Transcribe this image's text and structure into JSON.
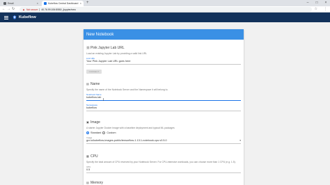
{
  "browser": {
    "tabs": [
      {
        "title": "Email",
        "active": false
      },
      {
        "title": "Kubeflow Central Dashboard",
        "active": true
      }
    ],
    "new_tab": "+",
    "window_controls": [
      "–",
      "□",
      "×"
    ],
    "security_label": "Not secure",
    "url": "40.76.99.106:8080/_/jupyter/new"
  },
  "appbar": {
    "title": "Kubeflow"
  },
  "form": {
    "title": "New Notebook",
    "pink_url": {
      "section_title": "Pink Jupyter Lab URL",
      "description": "Load an existing Jupyter Lab by providing a valid link URL",
      "field_label": "Link URL",
      "field_value": "Your Pink Jupyter Lab URL goes here",
      "button_label": "CONNECT"
    },
    "name": {
      "section_title": "Name",
      "description": "Specify the name of the Notebook Server and the Namespace it will belong to.",
      "name_label": "Notebook Name",
      "name_value": "kubeflow-lab",
      "namespace_label": "Namespace",
      "namespace_value": "kubeflow"
    },
    "image": {
      "section_title": "Image",
      "description": "A starter Jupyter Docker Image with a baseline deployment and typical ML packages",
      "option_standard": "Standard",
      "option_custom": "Custom",
      "image_label": "Image",
      "image_value": "gcr.io/kubeflow-images-public/tensorflow-1.13.1-notebook-cpu:v0.5.0"
    },
    "cpu": {
      "section_title": "CPU",
      "description": "Specify the total amount of CPU reserved by your Notebook Server. For CPU-intensive workloads, you can choose more than 1 CPU (e.g. 1.5).",
      "cpu_label": "CPU",
      "cpu_value": "0.5"
    },
    "memory": {
      "section_title": "Memory"
    }
  }
}
